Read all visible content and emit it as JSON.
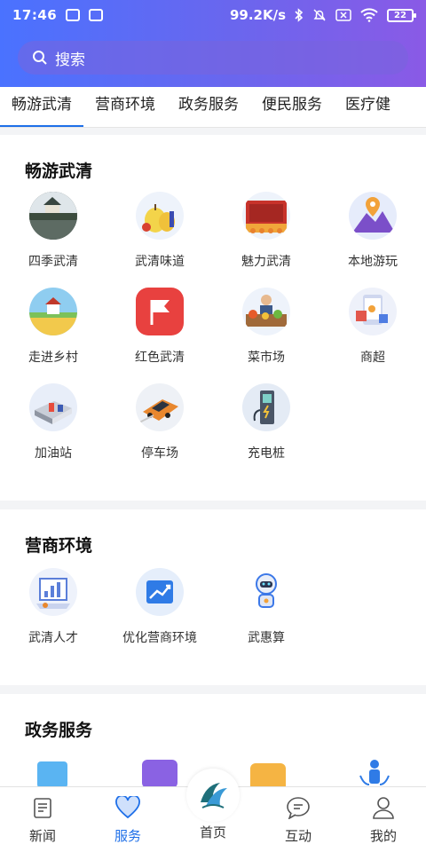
{
  "status_bar": {
    "time": "17:46",
    "network_speed": "99.2K/s",
    "battery": "22"
  },
  "search": {
    "placeholder": "搜索"
  },
  "tabs": [
    {
      "label": "畅游武清",
      "active": true
    },
    {
      "label": "营商环境",
      "active": false
    },
    {
      "label": "政务服务",
      "active": false
    },
    {
      "label": "便民服务",
      "active": false
    },
    {
      "label": "医疗健",
      "active": false
    }
  ],
  "sections": {
    "tour": {
      "title": "畅游武清",
      "items": [
        {
          "label": "四季武清",
          "icon": "tower-lake-icon"
        },
        {
          "label": "武清味道",
          "icon": "fruit-icon"
        },
        {
          "label": "魅力武清",
          "icon": "stage-icon"
        },
        {
          "label": "本地游玩",
          "icon": "location-mountain-icon"
        },
        {
          "label": "走进乡村",
          "icon": "farmhouse-icon"
        },
        {
          "label": "红色武清",
          "icon": "red-flag-icon"
        },
        {
          "label": "菜市场",
          "icon": "vegetable-stall-icon"
        },
        {
          "label": "商超",
          "icon": "supermarket-icon"
        },
        {
          "label": "加油站",
          "icon": "gas-station-icon"
        },
        {
          "label": "停车场",
          "icon": "parking-car-icon"
        },
        {
          "label": "充电桩",
          "icon": "charging-pile-icon"
        }
      ]
    },
    "business": {
      "title": "营商环境",
      "items": [
        {
          "label": "武清人才",
          "icon": "talent-chart-icon"
        },
        {
          "label": "优化营商环境",
          "icon": "growth-chart-icon"
        },
        {
          "label": "武惠算",
          "icon": "robot-icon"
        }
      ]
    },
    "gov": {
      "title": "政务服务"
    }
  },
  "bottom_nav": [
    {
      "label": "新闻",
      "icon": "news-icon",
      "active": false
    },
    {
      "label": "服务",
      "icon": "heart-icon",
      "active": true
    },
    {
      "label": "首页",
      "icon": "home-logo-icon",
      "active": false
    },
    {
      "label": "互动",
      "icon": "chat-icon",
      "active": false
    },
    {
      "label": "我的",
      "icon": "profile-icon",
      "active": false
    }
  ],
  "colors": {
    "accent": "#1e6fe8",
    "header_start": "#4a72ff",
    "header_end": "#8a5ae6"
  }
}
